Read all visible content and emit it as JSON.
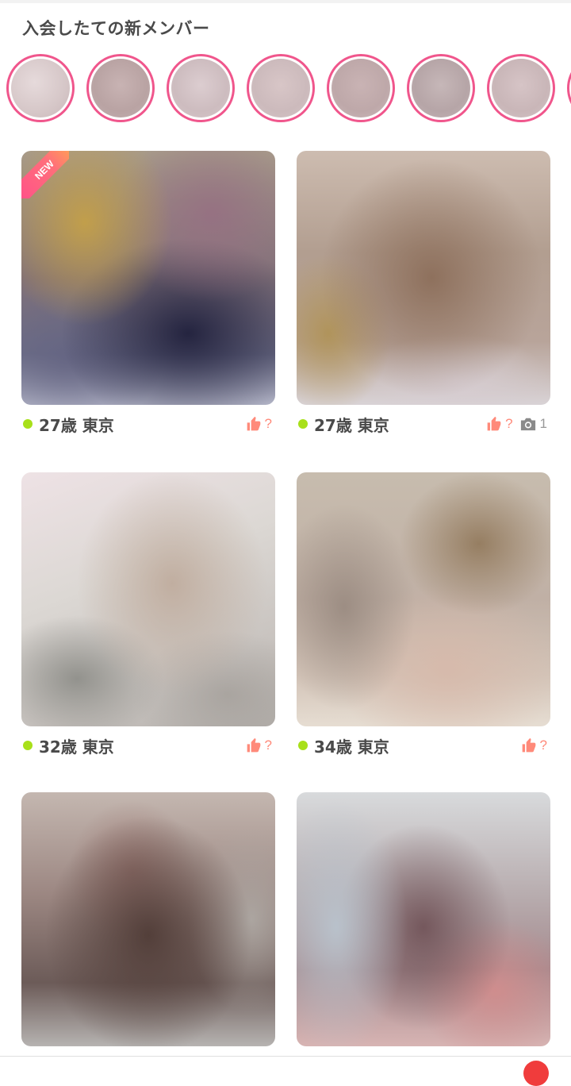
{
  "new_members": {
    "title": "入会したての新メンバー",
    "avatar_count": 8
  },
  "cards": [
    {
      "age_location": "27歳 東京",
      "like_status": "?",
      "photo_count": "",
      "is_new": true,
      "new_label": "NEW",
      "online": true
    },
    {
      "age_location": "27歳 東京",
      "like_status": "?",
      "photo_count": "1",
      "is_new": false,
      "online": true
    },
    {
      "age_location": "32歳 東京",
      "like_status": "?",
      "photo_count": "",
      "is_new": false,
      "online": true
    },
    {
      "age_location": "34歳 東京",
      "like_status": "?",
      "photo_count": "",
      "is_new": false,
      "online": true
    },
    {
      "age_location": "",
      "like_status": "",
      "photo_count": "",
      "is_new": false,
      "online": false
    },
    {
      "age_location": "",
      "like_status": "",
      "photo_count": "",
      "is_new": false,
      "online": false
    }
  ],
  "colors": {
    "avatar_ring": "#f0568c",
    "online_dot": "#a8e01a",
    "like_accent": "#ff8a7a",
    "text_primary": "#4a4a4a",
    "badge": "#f03c3c"
  },
  "icons": {
    "like": "thumbs-up-icon",
    "camera": "camera-icon"
  }
}
